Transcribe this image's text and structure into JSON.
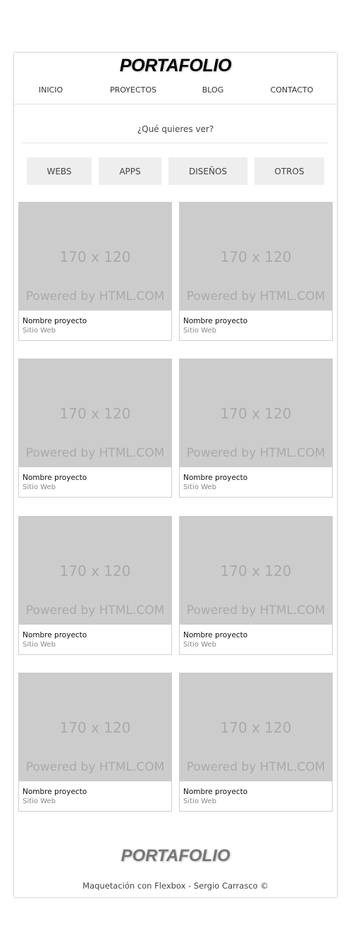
{
  "header": {
    "logo": "PORTAFOLIO"
  },
  "nav": {
    "items": [
      {
        "label": "INICIO"
      },
      {
        "label": "PROYECTOS"
      },
      {
        "label": "BLOG"
      },
      {
        "label": "CONTACTO"
      }
    ]
  },
  "filter": {
    "question": "¿Qué quieres ver?",
    "buttons": [
      {
        "label": "WEBS"
      },
      {
        "label": "APPS"
      },
      {
        "label": "DISEÑOS"
      },
      {
        "label": "OTROS"
      }
    ]
  },
  "projects": [
    {
      "image_dim": "170 x 120",
      "image_credit": "Powered by HTML.COM",
      "title": "Nombre proyecto",
      "category": "Sitio Web"
    },
    {
      "image_dim": "170 x 120",
      "image_credit": "Powered by HTML.COM",
      "title": "Nombre proyecto",
      "category": "Sitio Web"
    },
    {
      "image_dim": "170 x 120",
      "image_credit": "Powered by HTML.COM",
      "title": "Nombre proyecto",
      "category": "Sitio Web"
    },
    {
      "image_dim": "170 x 120",
      "image_credit": "Powered by HTML.COM",
      "title": "Nombre proyecto",
      "category": "Sitio Web"
    },
    {
      "image_dim": "170 x 120",
      "image_credit": "Powered by HTML.COM",
      "title": "Nombre proyecto",
      "category": "Sitio Web"
    },
    {
      "image_dim": "170 x 120",
      "image_credit": "Powered by HTML.COM",
      "title": "Nombre proyecto",
      "category": "Sitio Web"
    },
    {
      "image_dim": "170 x 120",
      "image_credit": "Powered by HTML.COM",
      "title": "Nombre proyecto",
      "category": "Sitio Web"
    },
    {
      "image_dim": "170 x 120",
      "image_credit": "Powered by HTML.COM",
      "title": "Nombre proyecto",
      "category": "Sitio Web"
    }
  ],
  "footer": {
    "logo": "PORTAFOLIO",
    "text": "Maquetación con Flexbox - Sergio Carrasco ©"
  }
}
